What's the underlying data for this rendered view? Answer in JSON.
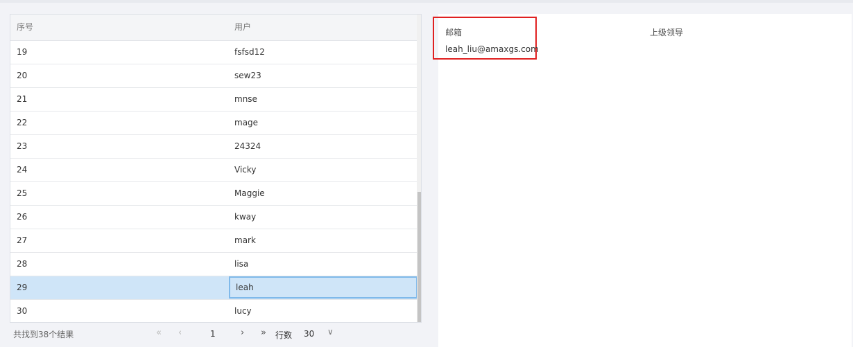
{
  "table": {
    "headers": [
      "序号",
      "用户"
    ],
    "rows": [
      {
        "index": "19",
        "user": "fsfsd12"
      },
      {
        "index": "20",
        "user": "sew23"
      },
      {
        "index": "21",
        "user": "mnse"
      },
      {
        "index": "22",
        "user": "mage"
      },
      {
        "index": "23",
        "user": "24324"
      },
      {
        "index": "24",
        "user": "Vicky"
      },
      {
        "index": "25",
        "user": "Maggie"
      },
      {
        "index": "26",
        "user": "kway"
      },
      {
        "index": "27",
        "user": "mark"
      },
      {
        "index": "28",
        "user": "lisa"
      },
      {
        "index": "29",
        "user": "leah"
      },
      {
        "index": "30",
        "user": "lucy"
      }
    ],
    "selected_index": "29"
  },
  "pager": {
    "total_text": "共找到38个结果",
    "first_glyph": "«",
    "prev_glyph": "‹",
    "current_page": "1",
    "next_glyph": "›",
    "last_glyph": "»",
    "rows_label": "行数",
    "rows_value": "30",
    "dropdown_glyph": "∨"
  },
  "detail": {
    "email_label": "邮箱",
    "email_value": "leah_liu@amaxgs.com",
    "leader_label": "上级领导",
    "leader_value": ""
  },
  "colors": {
    "selected_row": "#cfe5f8",
    "highlight_border": "#e02020"
  }
}
